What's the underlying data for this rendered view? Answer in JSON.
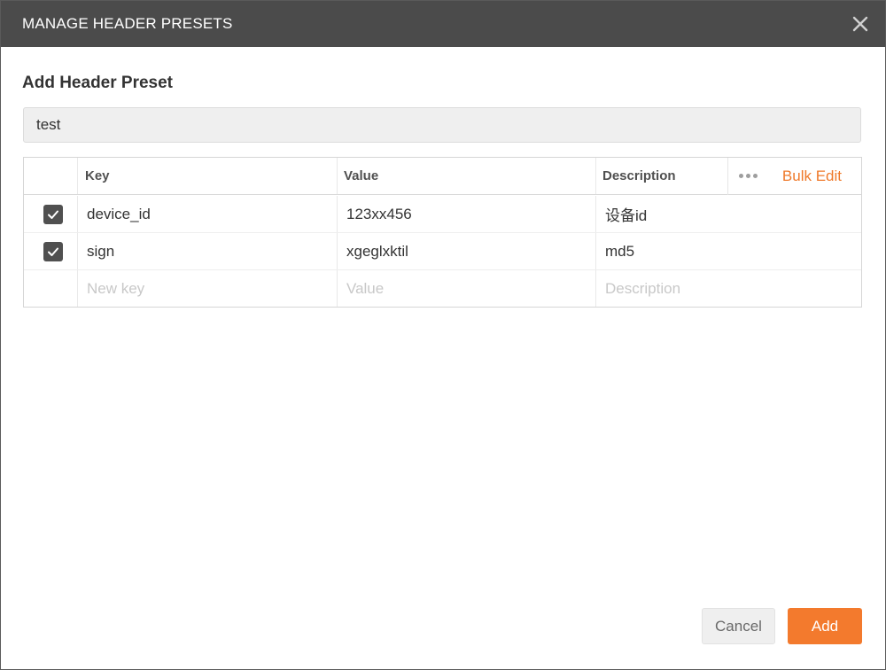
{
  "titlebar": {
    "title": "MANAGE HEADER PRESETS",
    "close_icon": "close-icon"
  },
  "form": {
    "section_title": "Add Header Preset",
    "preset_name_value": "test"
  },
  "table": {
    "columns": {
      "key": "Key",
      "value": "Value",
      "description": "Description"
    },
    "more_icon": "more-horizontal-icon",
    "bulk_edit_label": "Bulk Edit",
    "rows": [
      {
        "checked": true,
        "key": "device_id",
        "value": "123xx456",
        "description": "设备id"
      },
      {
        "checked": true,
        "key": "sign",
        "value": "xgeglxktil",
        "description": "md5"
      }
    ],
    "new_row_placeholders": {
      "key": "New key",
      "value": "Value",
      "description": "Description"
    }
  },
  "footer": {
    "cancel_label": "Cancel",
    "add_label": "Add"
  },
  "colors": {
    "titlebar_bg": "#4b4b4b",
    "accent": "#f37a2d",
    "checkbox": "#505050"
  }
}
